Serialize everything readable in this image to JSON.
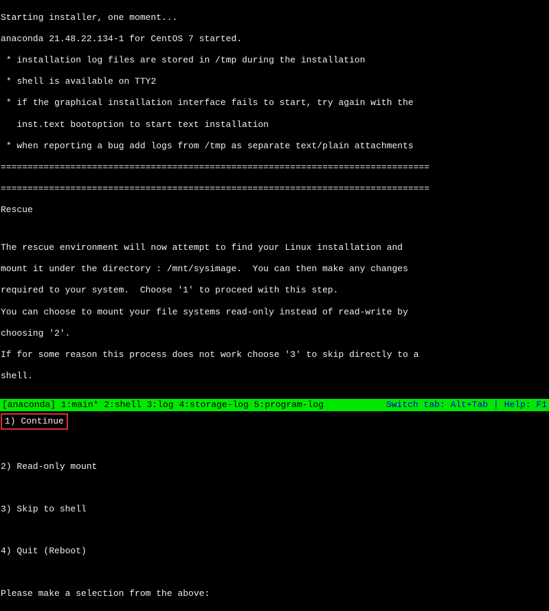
{
  "header": {
    "starting": "Starting installer, one moment...",
    "version": "anaconda 21.48.22.134-1 for CentOS 7 started.",
    "notes": [
      " * installation log files are stored in /tmp during the installation",
      " * shell is available on TTY2",
      " * if the graphical installation interface fails to start, try again with the",
      "   inst.text bootoption to start text installation",
      " * when reporting a bug add logs from /tmp as separate text/plain attachments"
    ],
    "separator": "================================================================================"
  },
  "rescue": {
    "title": "Rescue",
    "body": [
      "The rescue environment will now attempt to find your Linux installation and",
      "mount it under the directory : /mnt/sysimage.  You can then make any changes",
      "required to your system.  Choose '1' to proceed with this step.",
      "You can choose to mount your file systems read-only instead of read-write by",
      "choosing '2'.",
      "If for some reason this process does not work choose '3' to skip directly to a",
      "shell."
    ],
    "options": [
      "1) Continue",
      "2) Read-only mount",
      "3) Skip to shell",
      "4) Quit (Reboot)"
    ],
    "prompt": "Please make a selection from the above:"
  },
  "status": {
    "left": "[anaconda] 1:main* 2:shell  3:log  4:storage-log  5:program-log",
    "right": "Switch tab: Alt+Tab | Help: F1"
  }
}
